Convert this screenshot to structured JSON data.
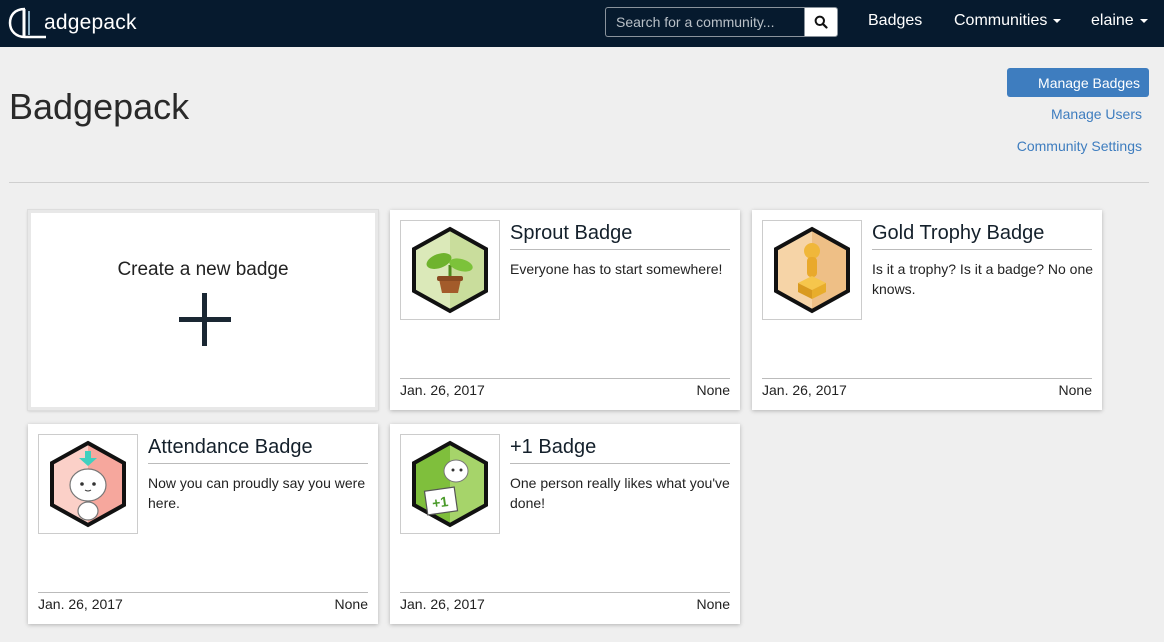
{
  "navbar": {
    "brand": "adgepack",
    "search_placeholder": "Search for a community...",
    "links": {
      "badges": "Badges",
      "communities": "Communities",
      "user": "elaine"
    }
  },
  "header": {
    "title": "Badgepack",
    "manage_badges": "Manage Badges",
    "manage_users": "Manage Users",
    "community_settings": "Community Settings"
  },
  "create_card": {
    "label": "Create a new badge"
  },
  "badges": [
    {
      "title": "Sprout Badge",
      "description": "Everyone has to start somewhere!",
      "date": "Jan. 26, 2017",
      "awarded": "None",
      "icon": "sprout-icon"
    },
    {
      "title": "Gold Trophy Badge",
      "description": "Is it a trophy? Is it a badge? No one knows.",
      "date": "Jan. 26, 2017",
      "awarded": "None",
      "icon": "trophy-icon"
    },
    {
      "title": "Attendance Badge",
      "description": "Now you can proudly say you were here.",
      "date": "Jan. 26, 2017",
      "awarded": "None",
      "icon": "attendance-icon"
    },
    {
      "title": "+1 Badge",
      "description": "One person really likes what you've done!",
      "date": "Jan. 26, 2017",
      "awarded": "None",
      "icon": "plus-one-icon",
      "sign_text": "+1"
    }
  ],
  "colors": {
    "navbar": "#061a2e",
    "accent": "#3e7dbf",
    "background": "#efefef"
  }
}
